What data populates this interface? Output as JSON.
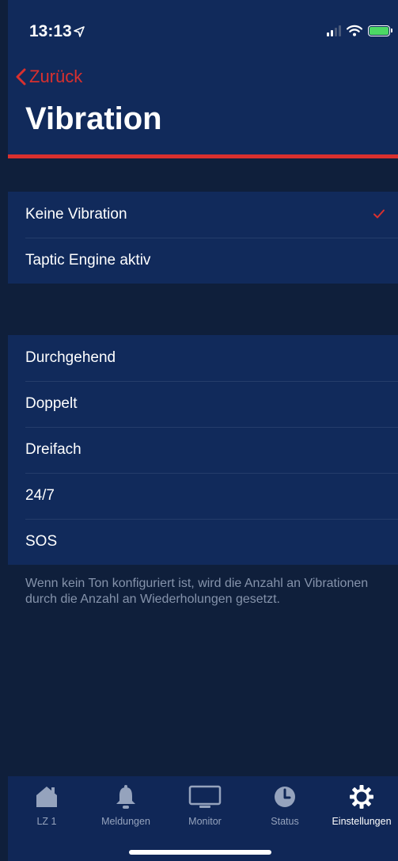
{
  "status_bar": {
    "time": "13:13"
  },
  "nav": {
    "back_label": "Zurück",
    "title": "Vibration"
  },
  "section1": {
    "items": [
      {
        "label": "Keine Vibration",
        "selected": true
      },
      {
        "label": "Taptic Engine aktiv",
        "selected": false
      }
    ]
  },
  "section2": {
    "items": [
      {
        "label": "Durchgehend"
      },
      {
        "label": "Doppelt"
      },
      {
        "label": "Dreifach"
      },
      {
        "label": "24/7"
      },
      {
        "label": "SOS"
      }
    ],
    "footer": "Wenn kein Ton konfiguriert ist, wird die Anzahl an Vibrationen durch die Anzahl an Wiederholungen gesetzt."
  },
  "tabbar": {
    "tabs": [
      {
        "label": "LZ 1",
        "icon": "home-icon",
        "active": false
      },
      {
        "label": "Meldungen",
        "icon": "bell-icon",
        "active": false
      },
      {
        "label": "Monitor",
        "icon": "monitor-icon",
        "active": false
      },
      {
        "label": "Status",
        "icon": "clock-icon",
        "active": false
      },
      {
        "label": "Einstellungen",
        "icon": "gear-icon",
        "active": true
      }
    ]
  },
  "colors": {
    "accent": "#d9302e",
    "header_bg": "#112a5b",
    "page_bg": "#0f1f3b",
    "battery": "#4cd964"
  }
}
